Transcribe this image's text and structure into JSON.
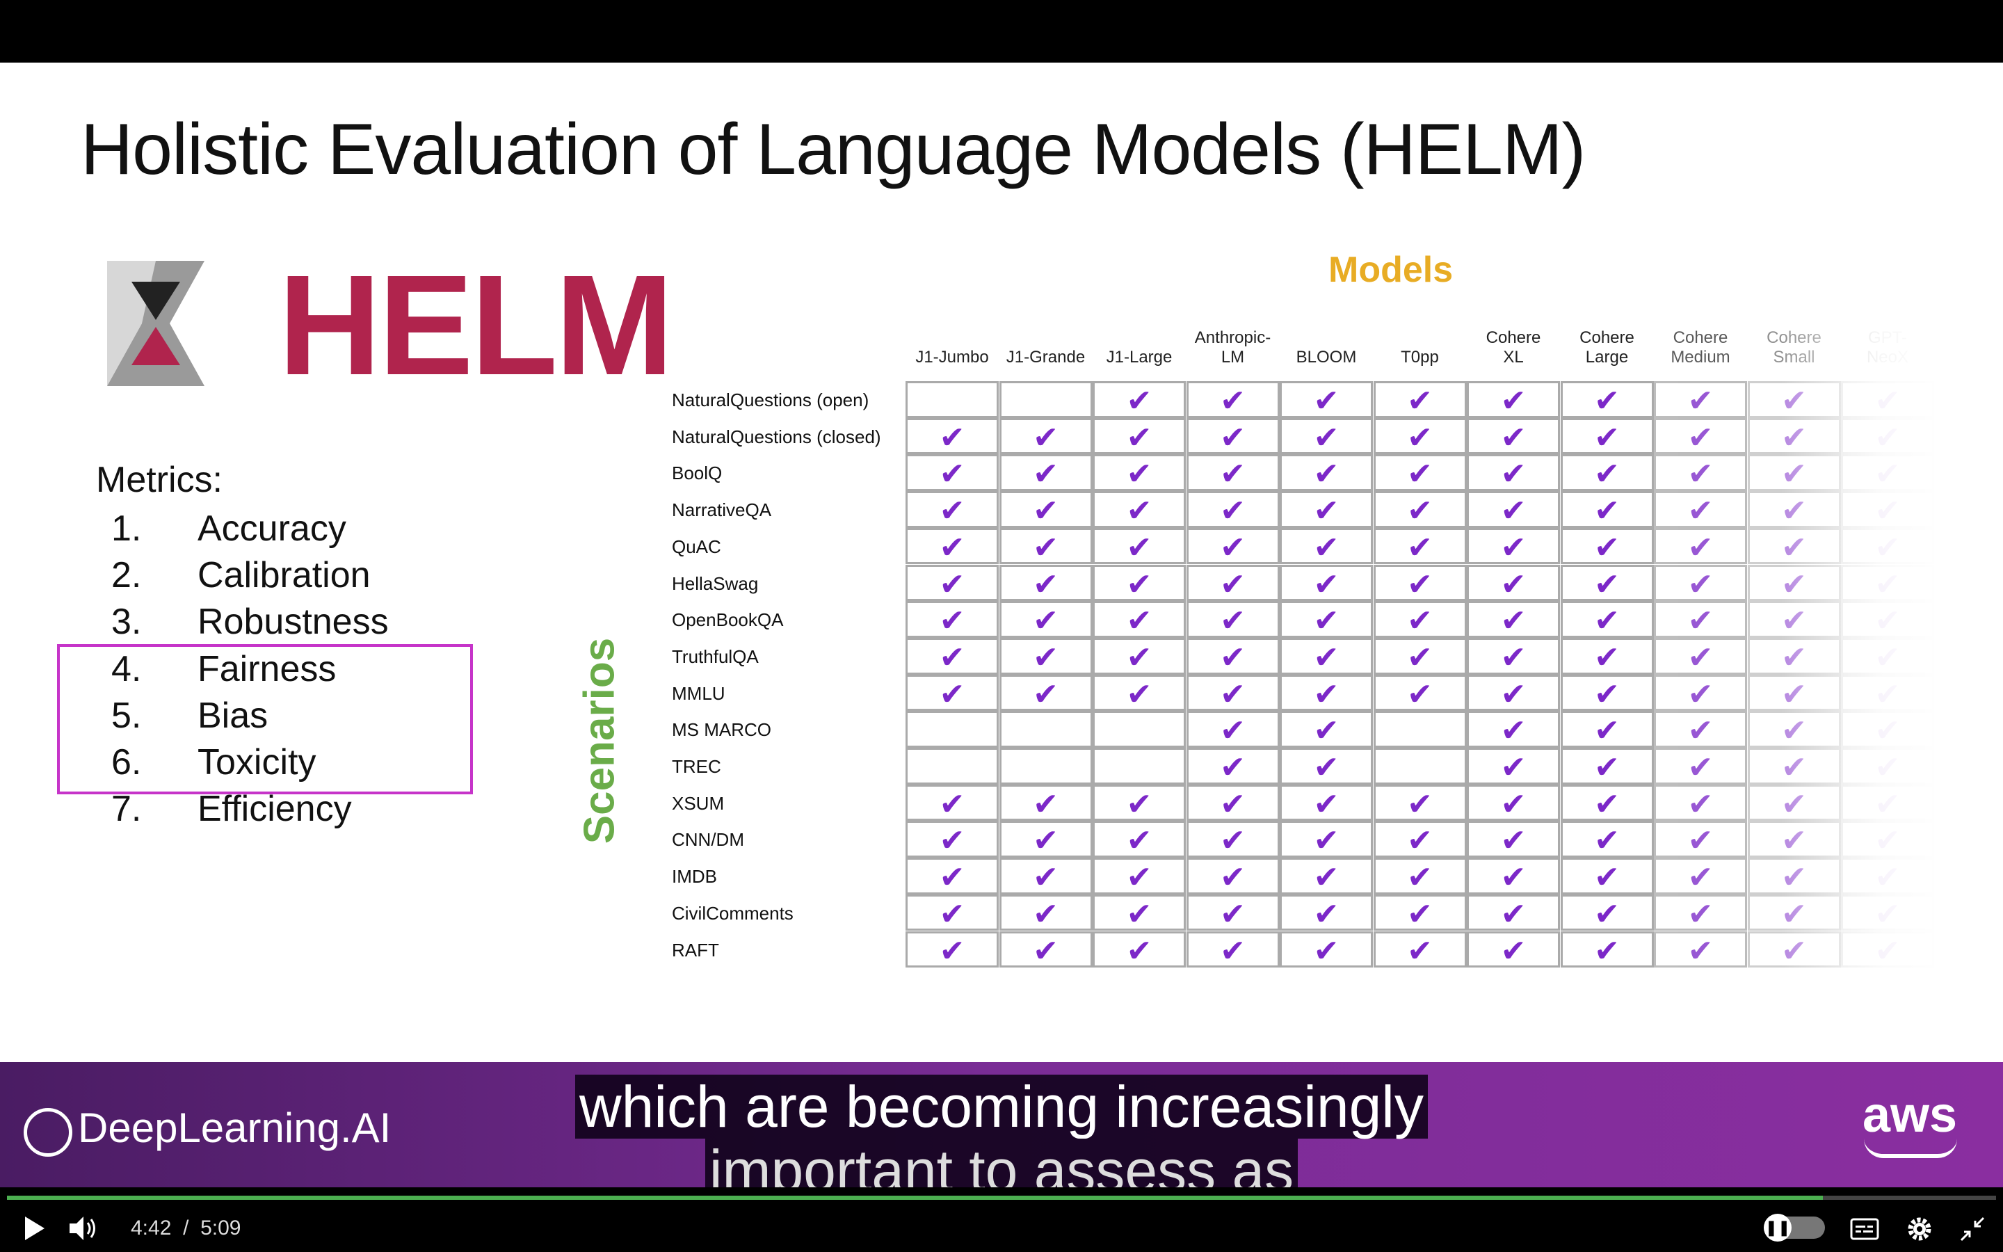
{
  "slide": {
    "title": "Holistic Evaluation of Language Models (HELM)",
    "logo_text": "HELM",
    "metrics_title": "Metrics:",
    "metrics": [
      {
        "num": "1.",
        "label": "Accuracy"
      },
      {
        "num": "2.",
        "label": "Calibration"
      },
      {
        "num": "3.",
        "label": "Robustness"
      },
      {
        "num": "4.",
        "label": "Fairness"
      },
      {
        "num": "5.",
        "label": "Bias"
      },
      {
        "num": "6.",
        "label": "Toxicity"
      },
      {
        "num": "7.",
        "label": "Efficiency"
      }
    ],
    "highlighted_metrics": [
      "Fairness",
      "Bias",
      "Toxicity"
    ],
    "models_label": "Models",
    "scenarios_label": "Scenarios",
    "table": {
      "columns": [
        "J1-Jumbo",
        "J1-Grande",
        "J1-Large",
        "Anthropic-\nLM",
        "BLOOM",
        "T0pp",
        "Cohere\nXL",
        "Cohere\nLarge",
        "Cohere\nMedium",
        "Cohere\nSmall",
        "GPT-\nNeoX"
      ],
      "check_mark": "✔",
      "check_color": "#7c28c8",
      "rows": [
        {
          "label": "NaturalQuestions (open)",
          "checks": [
            0,
            0,
            1,
            1,
            1,
            1,
            1,
            1,
            1,
            1,
            1
          ]
        },
        {
          "label": "NaturalQuestions (closed)",
          "checks": [
            1,
            1,
            1,
            1,
            1,
            1,
            1,
            1,
            1,
            1,
            1
          ]
        },
        {
          "label": "BoolQ",
          "checks": [
            1,
            1,
            1,
            1,
            1,
            1,
            1,
            1,
            1,
            1,
            1
          ]
        },
        {
          "label": "NarrativeQA",
          "checks": [
            1,
            1,
            1,
            1,
            1,
            1,
            1,
            1,
            1,
            1,
            1
          ]
        },
        {
          "label": "QuAC",
          "checks": [
            1,
            1,
            1,
            1,
            1,
            1,
            1,
            1,
            1,
            1,
            1
          ]
        },
        {
          "label": "HellaSwag",
          "checks": [
            1,
            1,
            1,
            1,
            1,
            1,
            1,
            1,
            1,
            1,
            1
          ]
        },
        {
          "label": "OpenBookQA",
          "checks": [
            1,
            1,
            1,
            1,
            1,
            1,
            1,
            1,
            1,
            1,
            1
          ]
        },
        {
          "label": "TruthfulQA",
          "checks": [
            1,
            1,
            1,
            1,
            1,
            1,
            1,
            1,
            1,
            1,
            1
          ]
        },
        {
          "label": "MMLU",
          "checks": [
            1,
            1,
            1,
            1,
            1,
            1,
            1,
            1,
            1,
            1,
            1
          ]
        },
        {
          "label": "MS MARCO",
          "checks": [
            0,
            0,
            0,
            1,
            1,
            0,
            1,
            1,
            1,
            1,
            1
          ]
        },
        {
          "label": "TREC",
          "checks": [
            0,
            0,
            0,
            1,
            1,
            0,
            1,
            1,
            1,
            1,
            1
          ]
        },
        {
          "label": "XSUM",
          "checks": [
            1,
            1,
            1,
            1,
            1,
            1,
            1,
            1,
            1,
            1,
            1
          ]
        },
        {
          "label": "CNN/DM",
          "checks": [
            1,
            1,
            1,
            1,
            1,
            1,
            1,
            1,
            1,
            1,
            1
          ]
        },
        {
          "label": "IMDB",
          "checks": [
            1,
            1,
            1,
            1,
            1,
            1,
            1,
            1,
            1,
            1,
            1
          ]
        },
        {
          "label": "CivilComments",
          "checks": [
            1,
            1,
            1,
            1,
            1,
            1,
            1,
            1,
            1,
            1,
            1
          ]
        },
        {
          "label": "RAFT",
          "checks": [
            1,
            1,
            1,
            1,
            1,
            1,
            1,
            1,
            1,
            1,
            1
          ]
        }
      ]
    }
  },
  "footer": {
    "brand": "DeepLearning.AI",
    "partner": "aws"
  },
  "subtitles": {
    "line1": "which are becoming increasingly",
    "line2": "important to assess as"
  },
  "player": {
    "current_time": "4:42",
    "separator": "/",
    "duration": "5:09",
    "progress_fraction": 0.913,
    "icons": [
      "play-icon",
      "volume-icon",
      "pause-toggle-icon",
      "captions-icon",
      "settings-icon",
      "exit-fullscreen-icon"
    ],
    "progress_color": "#4caf50"
  }
}
